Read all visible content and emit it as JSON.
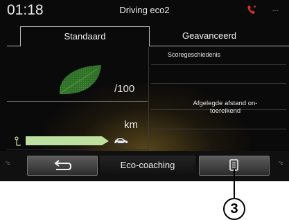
{
  "status": {
    "time": "01:18",
    "title": "Driving eco2",
    "phone_icon": "phone-icon",
    "signal_icon": "signal-icon",
    "signal_text": "---",
    "phone_color": "#d8322a"
  },
  "tabs": [
    {
      "label": "Standaard",
      "active": true
    },
    {
      "label": "Geavanceerd",
      "active": false
    }
  ],
  "score": {
    "max_label": "/100",
    "leaf_icon": "leaf-icon",
    "leaf_color": "#3b7d2f"
  },
  "distance": {
    "unit": "km",
    "start_icon": "pin-icon",
    "car_icon": "car-icon",
    "bar_color": "#bde0a0"
  },
  "history": {
    "title": "Scoregeschiedenis",
    "message_line1": "Afgelegde afstand on-",
    "message_line2": "toereikend"
  },
  "bottom_bar": {
    "back_icon": "back-arrow-icon",
    "center_label": "Eco-coaching",
    "menu_icon": "list-icon",
    "left_marker": "°c",
    "right_marker": "°c"
  },
  "callout": {
    "number": "3"
  }
}
